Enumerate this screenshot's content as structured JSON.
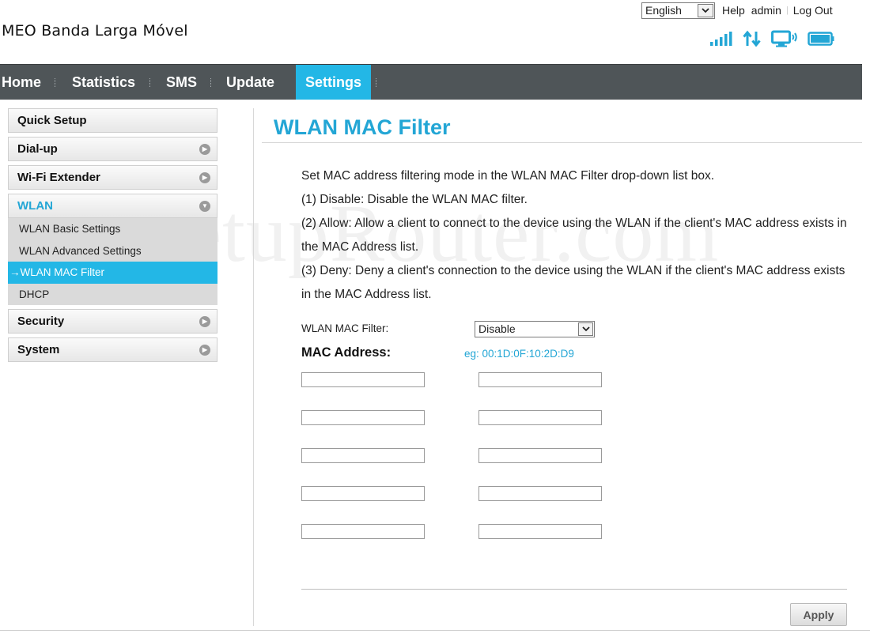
{
  "header": {
    "brand": "MEO Banda Larga Móvel",
    "language": "English",
    "help": "Help",
    "user": "admin",
    "logout": "Log Out",
    "status_icons": [
      "signal-strength-icon",
      "data-transfer-icon",
      "wifi-connected-device-icon",
      "battery-icon"
    ],
    "icon_color": "#23a6d5"
  },
  "nav": {
    "tabs": [
      {
        "label": "Home"
      },
      {
        "label": "Statistics"
      },
      {
        "label": "SMS"
      },
      {
        "label": "Update"
      },
      {
        "label": "Settings"
      }
    ],
    "active": "Settings",
    "bar_color": "#4f5558",
    "active_color": "#23b7e6"
  },
  "sidebar": {
    "items": [
      {
        "label": "Quick Setup"
      },
      {
        "label": "Dial-up"
      },
      {
        "label": "Wi-Fi Extender"
      },
      {
        "label": "WLAN"
      },
      {
        "label": "Security"
      },
      {
        "label": "System"
      }
    ],
    "wlan_sub": [
      {
        "label": "WLAN Basic Settings"
      },
      {
        "label": "WLAN Advanced Settings"
      },
      {
        "label": "WLAN MAC Filter"
      },
      {
        "label": "DHCP"
      }
    ],
    "active_sub": "WLAN MAC Filter",
    "active_arrow": "→"
  },
  "main": {
    "title": "WLAN MAC Filter",
    "description": [
      "Set MAC address filtering mode in the WLAN MAC Filter drop-down list box.",
      "(1) Disable: Disable the WLAN MAC filter.",
      "(2) Allow: Allow a client to connect to the device using the WLAN if the client's MAC address exists in the MAC Address list.",
      "(3) Deny: Deny a client's connection to the device using the WLAN if the client's MAC address exists in the MAC Address list."
    ],
    "filter_label": "WLAN MAC Filter:",
    "filter_value": "Disable",
    "mac_heading": "MAC Address:",
    "mac_example": "eg: 00:1D:0F:10:2D:D9",
    "mac_values": [
      "",
      "",
      "",
      "",
      "",
      "",
      "",
      "",
      "",
      ""
    ],
    "apply_label": "Apply"
  },
  "watermark": "SetupRouter.com"
}
